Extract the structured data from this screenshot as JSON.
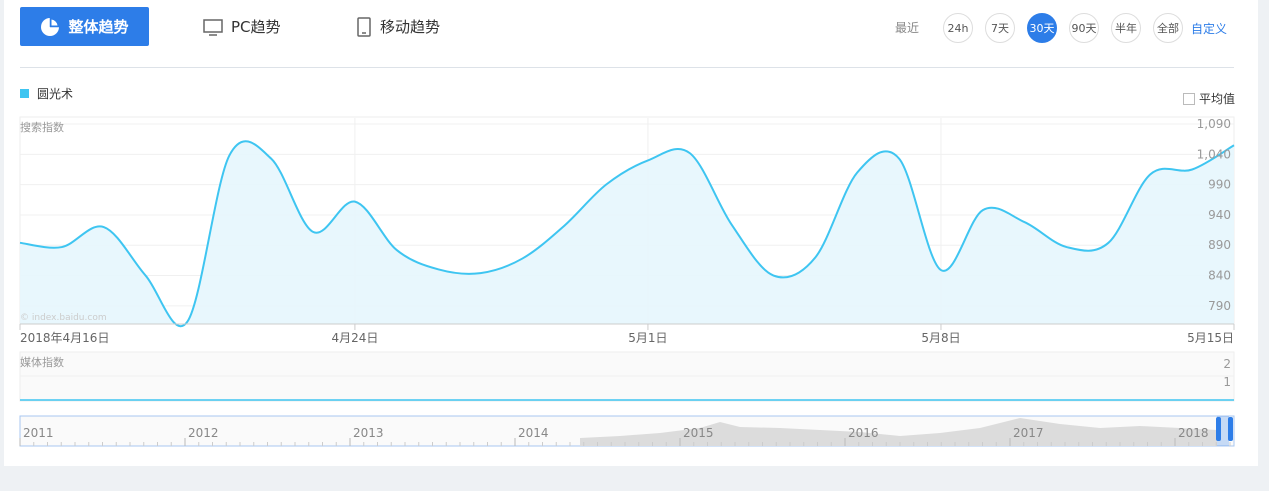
{
  "tabs": {
    "overall": "整体趋势",
    "pc": "PC趋势",
    "mobile": "移动趋势"
  },
  "time_range": {
    "label": "最近",
    "options": [
      "24h",
      "7天",
      "30天",
      "90天",
      "半年",
      "全部"
    ],
    "active": "30天",
    "custom": "自定义"
  },
  "average_toggle": "平均值",
  "colors": {
    "accent": "#2d7de8",
    "series": "#3ec5f1"
  },
  "watermark": "index.baidu.com",
  "chart_data": [
    {
      "type": "area",
      "ylabel": "搜索指数",
      "series": [
        {
          "name": "圆光术",
          "x": [
            "2018-04-16",
            "2018-04-17",
            "2018-04-18",
            "2018-04-19",
            "2018-04-20",
            "2018-04-21",
            "2018-04-22",
            "2018-04-23",
            "2018-04-24",
            "2018-04-25",
            "2018-04-26",
            "2018-04-27",
            "2018-04-28",
            "2018-04-29",
            "2018-04-30",
            "2018-05-01",
            "2018-05-02",
            "2018-05-03",
            "2018-05-04",
            "2018-05-05",
            "2018-05-06",
            "2018-05-07",
            "2018-05-08",
            "2018-05-09",
            "2018-05-10",
            "2018-05-11",
            "2018-05-12",
            "2018-05-13",
            "2018-05-14",
            "2018-05-15"
          ],
          "values": [
            894,
            887,
            920,
            840,
            764,
            1038,
            1033,
            912,
            962,
            882,
            850,
            844,
            868,
            922,
            990,
            1030,
            1042,
            924,
            840,
            870,
            1010,
            1033,
            849,
            948,
            928,
            887,
            894,
            1007,
            1015,
            1055
          ]
        }
      ],
      "yticks": [
        790,
        840,
        890,
        940,
        990,
        1040,
        1090
      ],
      "ytick_labels": [
        "790",
        "840",
        "890",
        "940",
        "990",
        "1,040",
        "1,090"
      ],
      "ylim": [
        760,
        1100
      ],
      "xtick_labels": [
        {
          "date": "2018-04-16",
          "label": "2018年4月16日"
        },
        {
          "date": "2018-04-24",
          "label": "4月24日"
        },
        {
          "date": "2018-05-01",
          "label": "5月1日"
        },
        {
          "date": "2018-05-08",
          "label": "5月8日"
        },
        {
          "date": "2018-05-15",
          "label": "5月15日"
        }
      ],
      "grid": true
    },
    {
      "type": "line",
      "ylabel": "媒体指数",
      "yticks": [
        1,
        2
      ],
      "values": [
        0,
        0
      ]
    },
    {
      "type": "area",
      "role": "range-navigator",
      "x_labels": [
        "2011",
        "2012",
        "2013",
        "2014",
        "2015",
        "2016",
        "2017",
        "2018"
      ]
    }
  ]
}
